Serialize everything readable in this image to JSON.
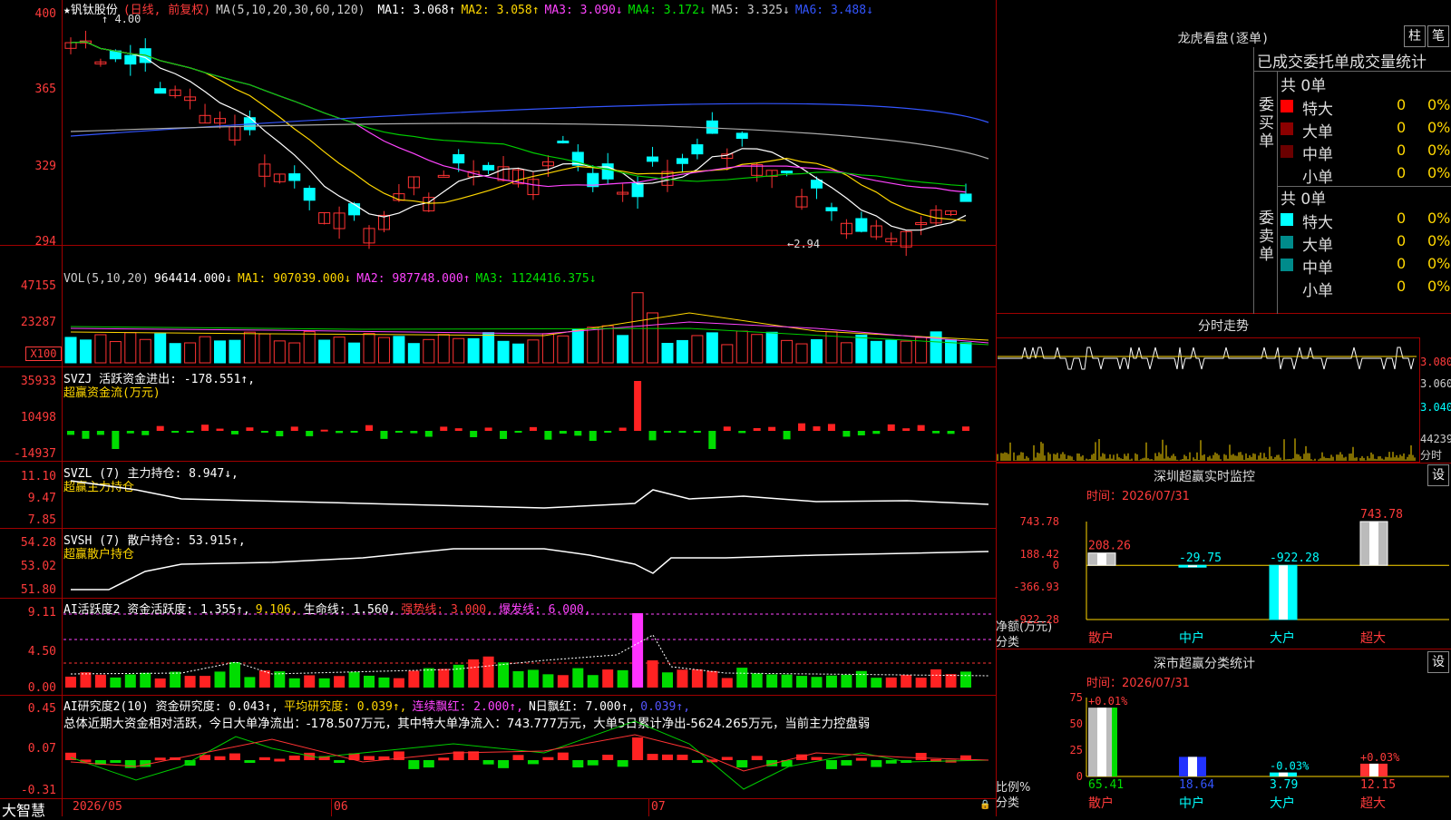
{
  "stock": {
    "name": "★钒钛股份",
    "period": "(日线, 前复权)",
    "ma_header": "MA(5,10,20,30,60,120)",
    "ma": [
      {
        "label": "MA1:",
        "value": "3.068↑",
        "color": "#ffffff"
      },
      {
        "label": "MA2:",
        "value": "3.058↑",
        "color": "#ffd700"
      },
      {
        "label": "MA3:",
        "value": "3.090↓",
        "color": "#ff44ff"
      },
      {
        "label": "MA4:",
        "value": "3.172↓",
        "color": "#00e000"
      },
      {
        "label": "MA5:",
        "value": "3.325↓",
        "color": "#cccccc"
      },
      {
        "label": "MA6:",
        "value": "3.488↓",
        "color": "#3355ff"
      }
    ],
    "high_marker": "4.00",
    "low_marker": "←2.94",
    "price_axis": [
      "400",
      "365",
      "329",
      "294"
    ]
  },
  "vol": {
    "header": "VOL(5,10,20)",
    "value": "964414.000↓",
    "ma1": "MA1: 907039.000↓",
    "ma2": "MA2: 987748.000↑",
    "ma3": "MA3: 1124416.375↓",
    "axis": [
      "47155",
      "23287"
    ],
    "unit": "X100"
  },
  "svzj": {
    "header": "SVZJ  活跃资金进出: -178.551↑,",
    "sub": "超赢资金流(万元)",
    "axis": [
      "35933",
      "10498",
      "-14937"
    ]
  },
  "svzl": {
    "header": "SVZL (7) 主力持仓: 8.947↓,",
    "sub": "超赢主力持仓",
    "axis": [
      "11.10",
      "9.47",
      "7.85"
    ]
  },
  "svsh": {
    "header": "SVSH (7) 散户持仓: 53.915↑,",
    "sub": "超赢散户持仓",
    "axis": [
      "54.28",
      "53.02",
      "51.80"
    ]
  },
  "ai1": {
    "header": "AI活跃度2 资金活跃度: 1.355↑,",
    "v2": "9.106,",
    "life": "生命线: 1.560,",
    "strong": "强势线: 3.000,",
    "burst": "爆发线: 6.000,",
    "axis": [
      "9.11",
      "4.50",
      "0.00"
    ]
  },
  "ai2": {
    "header": "AI研究度2(10) 资金研究度: 0.043↑,",
    "avg": "平均研究度: 0.039↑,",
    "streak": "连续飘红: 2.000↑,",
    "nday": "N日飘红: 7.000↑,",
    "last": "0.039↑,",
    "summary": "总体近期大资金相对活跃，今日大单净流出：-178.507万元，其中特大单净流入：743.777万元，大单5日累计净出-5624.265万元，当前主力控盘弱",
    "axis": [
      "0.45",
      "0.07",
      "-0.31"
    ]
  },
  "date_axis": {
    "brand": "大智慧",
    "labels": [
      "2026/05",
      "06",
      "07"
    ]
  },
  "right": {
    "lhb": {
      "title": "龙虎看盘(逐单)",
      "btn1": "柱",
      "btn2": "笔",
      "header": "已成交委托单成交量统计",
      "buy": {
        "side": "委买单",
        "total": "共 0单",
        "rows": [
          {
            "label": "特大",
            "val": "0",
            "pct": "0%",
            "color": "#ff0000"
          },
          {
            "label": "大单",
            "val": "0",
            "pct": "0%",
            "color": "#8b0000"
          },
          {
            "label": "中单",
            "val": "0",
            "pct": "0%",
            "color": "#6b0000"
          },
          {
            "label": "小单",
            "val": "0",
            "pct": "0%",
            "color": ""
          }
        ]
      },
      "sell": {
        "side": "委卖单",
        "total": "共 0单",
        "rows": [
          {
            "label": "特大",
            "val": "0",
            "pct": "0%",
            "color": "#00ffff"
          },
          {
            "label": "大单",
            "val": "0",
            "pct": "0%",
            "color": "#008b8b"
          },
          {
            "label": "中单",
            "val": "0",
            "pct": "0%",
            "color": "#008b8b"
          },
          {
            "label": "小单",
            "val": "0",
            "pct": "0%",
            "color": ""
          }
        ]
      }
    },
    "fenshi": {
      "title": "分时走势",
      "axis": [
        "3.080",
        "3.060",
        "3.040"
      ],
      "vol": "44239",
      "foot": "分时"
    },
    "sz_monitor": {
      "title": "深圳超赢实时监控",
      "btn": "设",
      "time": "时间：2026/07/31",
      "axis": [
        "743.78",
        "188.42",
        "0",
        "-366.93",
        "-922.28"
      ],
      "ylabel": "净额(万元)",
      "xlabel": "分类",
      "cats": [
        "散户",
        "中户",
        "大户",
        "超大"
      ],
      "vals": [
        "208.26",
        "-29.75",
        "-922.28",
        "743.78"
      ]
    },
    "sz_class": {
      "title": "深市超赢分类统计",
      "btn": "设",
      "time": "时间：2026/07/31",
      "axis": [
        "75",
        "50",
        "25",
        "0"
      ],
      "ylabel": "比例%",
      "xlabel": "分类",
      "cats": [
        "散户",
        "中户",
        "大户",
        "超大"
      ],
      "pcts": [
        "65.41",
        "18.64",
        "3.79",
        "12.15"
      ],
      "deltas": [
        "+0.01%",
        "",
        "-0.03%",
        "+0.03%"
      ]
    }
  }
}
